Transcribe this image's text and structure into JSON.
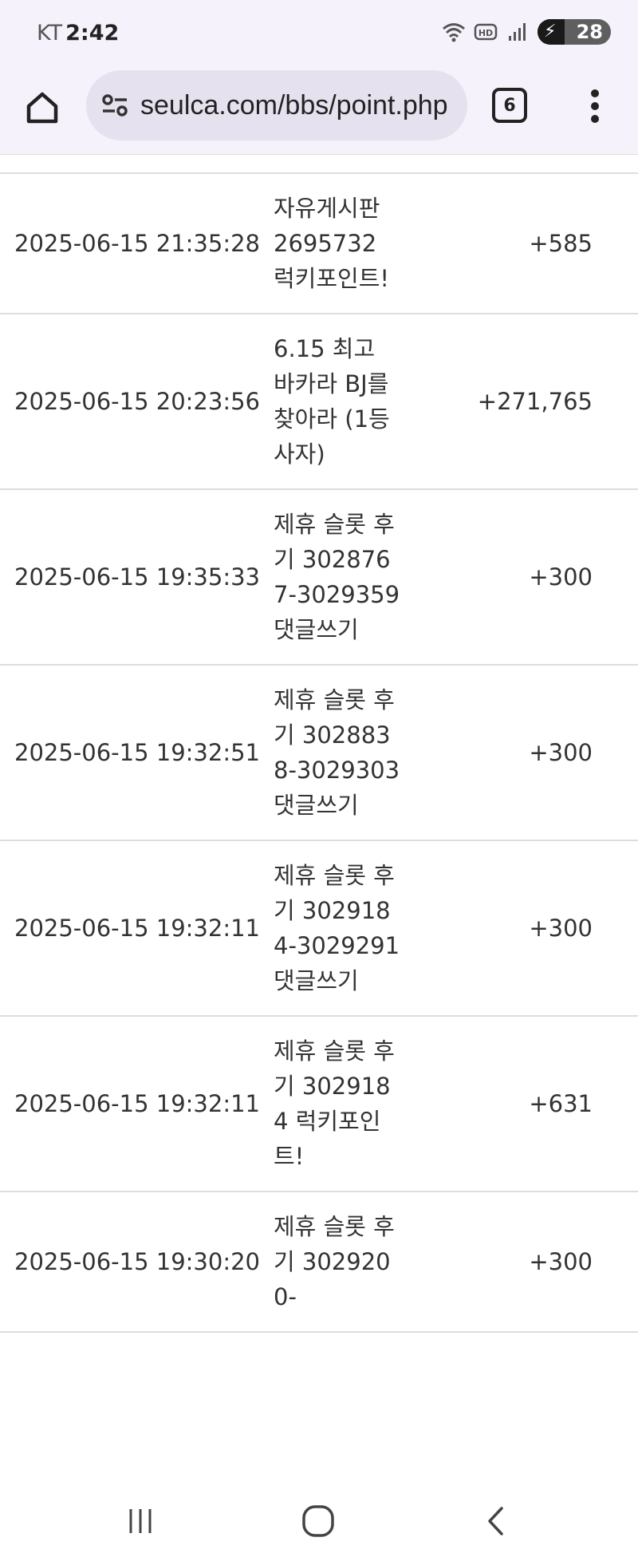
{
  "status_bar": {
    "carrier": "KT",
    "time": "2:42",
    "battery": "28",
    "icons": [
      "wifi-icon",
      "hd-voice-icon",
      "signal-icon",
      "battery-charging-icon"
    ]
  },
  "browser": {
    "url": "seulca.com/bbs/point.php",
    "tab_count": "6",
    "icons": [
      "home-icon",
      "site-settings-icon",
      "tab-switcher-icon",
      "more-menu-icon"
    ]
  },
  "point_history": {
    "rows": [
      {
        "datetime": "2025-06-15 21:35:28",
        "description": "자유게시판 2695732 럭키포인트!",
        "points": "+585"
      },
      {
        "datetime": "2025-06-15 20:23:56",
        "description": "6.15 최고 바카라 BJ를 찾아라 (1등 사자)",
        "points": "+271,765"
      },
      {
        "datetime": "2025-06-15 19:35:33",
        "description": "제휴 슬롯 후기 3028767-3029359 댓글쓰기",
        "points": "+300"
      },
      {
        "datetime": "2025-06-15 19:32:51",
        "description": "제휴 슬롯 후기 3028838-3029303 댓글쓰기",
        "points": "+300"
      },
      {
        "datetime": "2025-06-15 19:32:11",
        "description": "제휴 슬롯 후기 3029184-3029291 댓글쓰기",
        "points": "+300"
      },
      {
        "datetime": "2025-06-15 19:32:11",
        "description": "제휴 슬롯 후기 3029184 럭키포인트!",
        "points": "+631"
      },
      {
        "datetime": "2025-06-15 19:30:20",
        "description": "제휴 슬롯 후기 3029200-",
        "points": "+300"
      }
    ]
  },
  "nav_bar": {
    "icons": [
      "recent-apps-icon",
      "home-circle-icon",
      "back-icon"
    ]
  }
}
